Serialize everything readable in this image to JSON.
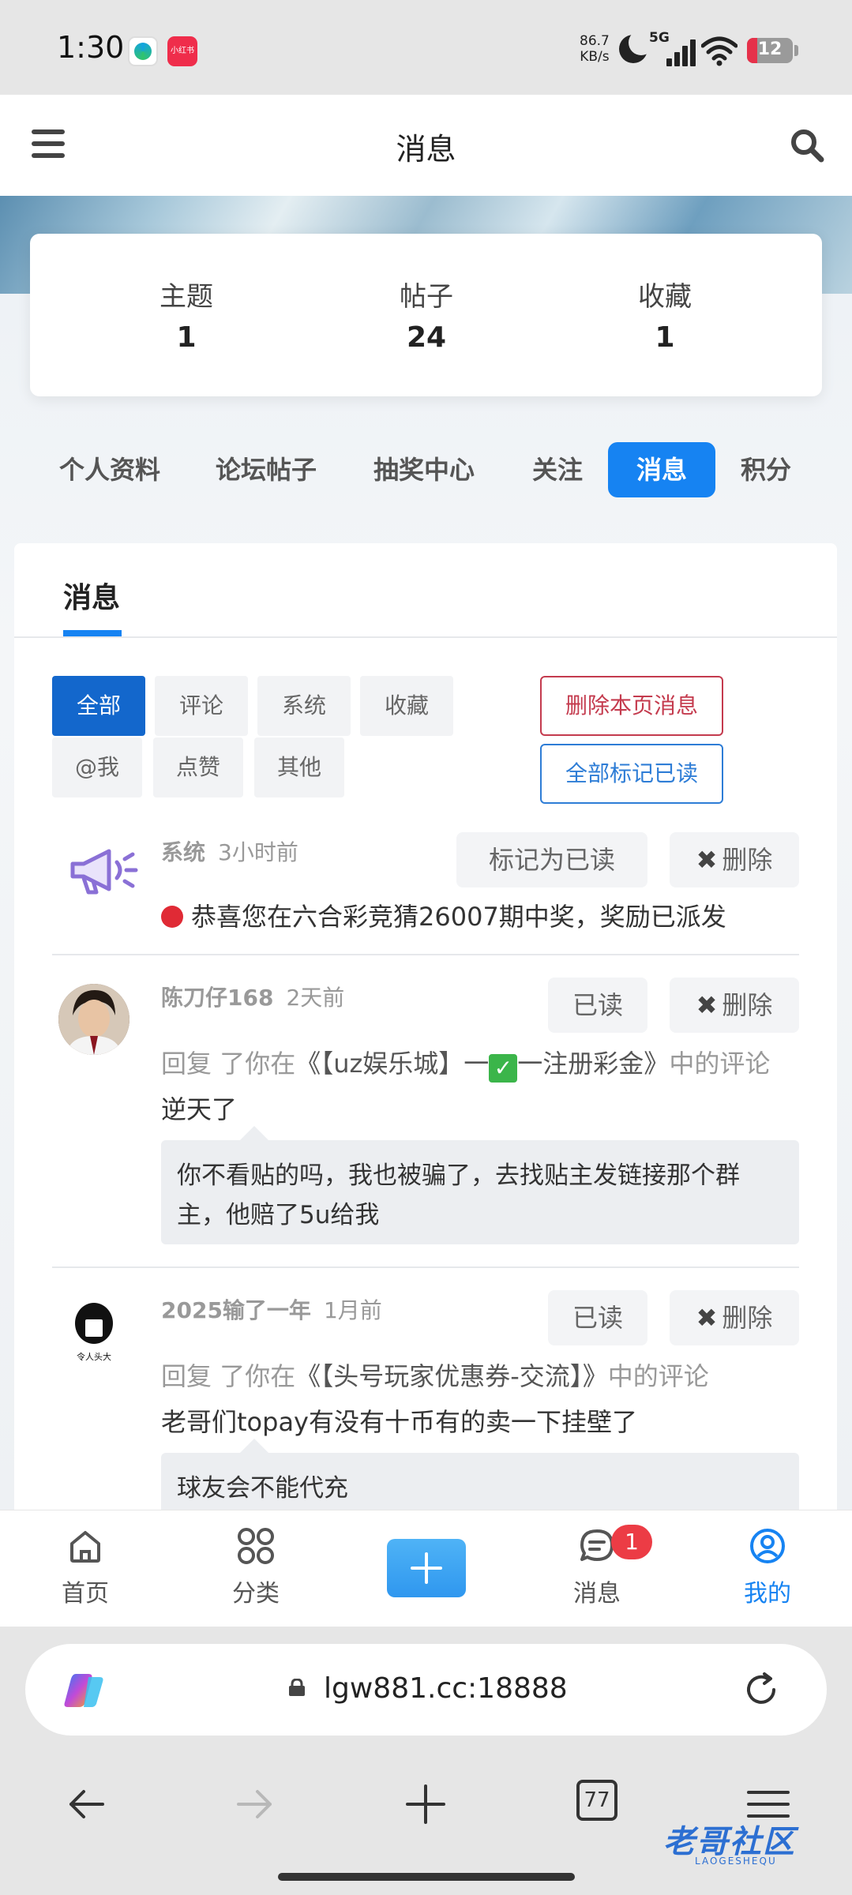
{
  "status_bar": {
    "time": "1:30",
    "net_speed_value": "86.7",
    "net_speed_unit": "KB/s",
    "network": "5G",
    "battery": "12",
    "app2_label": "小红书"
  },
  "header": {
    "title": "消息"
  },
  "stats": [
    {
      "label": "主题",
      "value": "1"
    },
    {
      "label": "帖子",
      "value": "24"
    },
    {
      "label": "收藏",
      "value": "1"
    }
  ],
  "nav_tabs": [
    "个人资料",
    "论坛帖子",
    "抽奖中心",
    "关注",
    "消息",
    "积分"
  ],
  "active_nav_tab": "消息",
  "panel": {
    "tab": "消息",
    "filters": [
      "全部",
      "评论",
      "系统",
      "收藏",
      "@我",
      "点赞",
      "其他"
    ],
    "active_filter": "全部",
    "delete_page_label": "删除本页消息",
    "mark_all_read_label": "全部标记已读"
  },
  "messages": [
    {
      "author": "系统",
      "time": "3小时前",
      "read_button": "标记为已读",
      "delete_button": "删除",
      "delete_x": "✖",
      "body": "恭喜您在六合彩竞猜26007期中奖，奖励已派发"
    },
    {
      "author": "陈刀仔168",
      "time": "2天前",
      "read_button": "已读",
      "delete_button": "删除",
      "delete_x": "✖",
      "reply_prefix": "回复",
      "reply_mid": "了你在",
      "thread_before": "《【uz娱乐城】一",
      "thread_check": "✓",
      "thread_after": "一注册彩金》",
      "reply_suffix": "中的评论",
      "body": "逆天了",
      "quote": "你不看贴的吗，我也被骗了，去找贴主发链接那个群主，他赔了5u给我"
    },
    {
      "author": "2025输了一年",
      "time": "1月前",
      "read_button": "已读",
      "delete_button": "删除",
      "delete_x": "✖",
      "reply_prefix": "回复",
      "reply_mid": "了你在",
      "thread": "《【头号玩家优惠券-交流】》",
      "reply_suffix": "中的评论",
      "body": "老哥们topay有没有十币有的卖一下挂壁了",
      "quote": "球友会不能代充"
    }
  ],
  "bottom_nav": [
    {
      "label": "首页",
      "icon": "home-icon"
    },
    {
      "label": "分类",
      "icon": "grid-icon"
    },
    {
      "label": "消息",
      "icon": "chat-icon",
      "badge": "1"
    },
    {
      "label": "我的",
      "icon": "user-icon"
    }
  ],
  "browser": {
    "url": "lgw881.cc:18888",
    "tab_count": "77"
  },
  "watermark": {
    "text": "老哥社区",
    "sub": "LAOGESHEQU"
  },
  "colors": {
    "accent": "#1683f2",
    "filter_active": "#1367cc",
    "danger": "#c43b4e",
    "badge": "#ec3c45"
  }
}
